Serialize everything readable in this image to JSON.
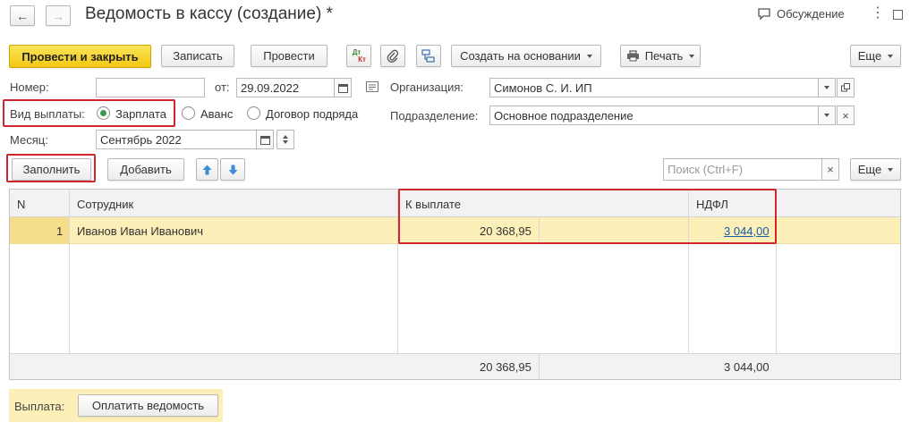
{
  "window": {
    "title": "Ведомость в кассу (создание) *",
    "discussion_label": "Обсуждение"
  },
  "toolbar": {
    "post_close": "Провести и закрыть",
    "save": "Записать",
    "post": "Провести",
    "dt_kt_top": "Дт",
    "dt_kt_bottom": "Кт",
    "create_based": "Создать на основании",
    "print": "Печать",
    "more": "Еще"
  },
  "form": {
    "number_label": "Номер:",
    "number_value": "",
    "date_label": "от:",
    "date_value": "29.09.2022",
    "org_label": "Организация:",
    "org_value": "Симонов С. И. ИП",
    "payment_type_label": "Вид выплаты:",
    "payment_options": [
      "Зарплата",
      "Аванс",
      "Договор подряда"
    ],
    "payment_selected": "Зарплата",
    "division_label": "Подразделение:",
    "division_value": "Основное подразделение",
    "month_label": "Месяц:",
    "month_value": "Сентябрь 2022"
  },
  "table_toolbar": {
    "fill": "Заполнить",
    "add": "Добавить",
    "search_placeholder": "Поиск (Ctrl+F)",
    "clear": "×",
    "more": "Еще"
  },
  "table": {
    "columns": [
      "N",
      "Сотрудник",
      "К выплате",
      "НДФЛ"
    ],
    "rows": [
      {
        "n": "1",
        "employee": "Иванов Иван Иванович",
        "to_pay": "20 368,95",
        "ndfl": "3 044,00"
      }
    ],
    "totals": {
      "to_pay": "20 368,95",
      "ndfl": "3 044,00"
    }
  },
  "footer": {
    "payout_label": "Выплата:",
    "pay_button": "Оплатить ведомость"
  },
  "colors": {
    "primary_button": "#f3c814",
    "selected_row": "#fcefb8",
    "highlight_box": "#d0262e",
    "link": "#1a5aa6"
  }
}
